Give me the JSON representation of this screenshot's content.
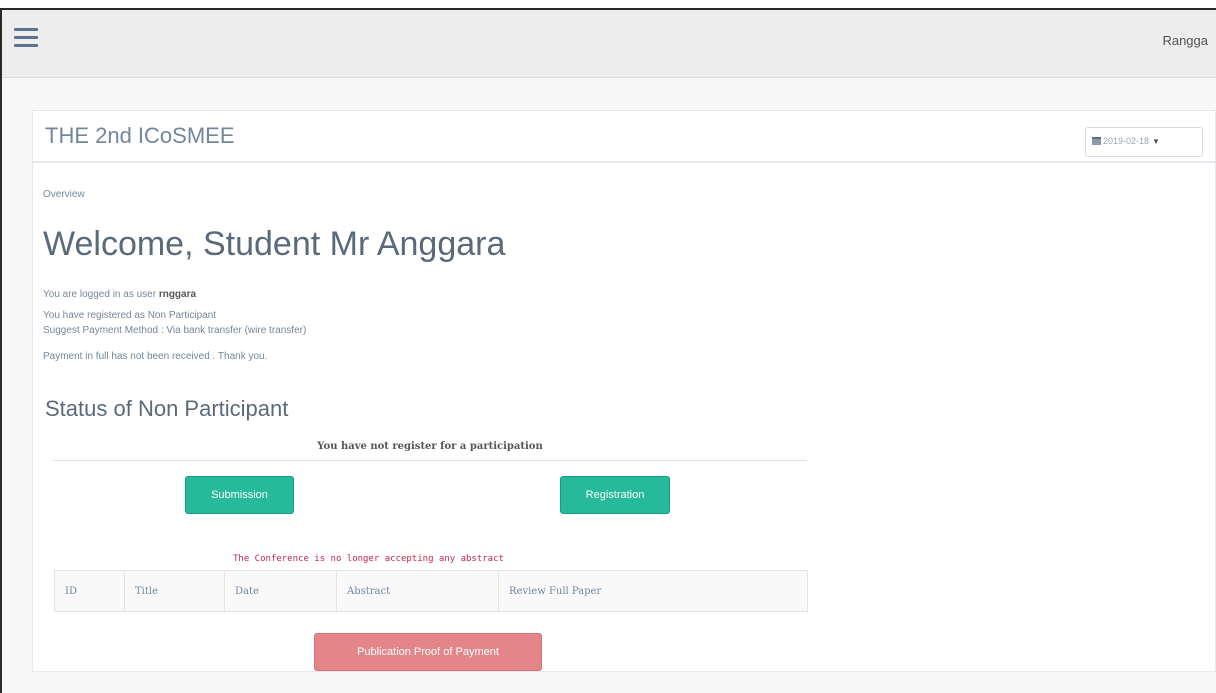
{
  "header": {
    "username": "Rangga"
  },
  "panel": {
    "title": "THE 2nd ICoSMEE",
    "date_selected": "2019-02-18"
  },
  "breadcrumb": "Overview",
  "welcome": {
    "heading": "Welcome, Student Mr Anggara",
    "logged_in_prefix": "You are logged in as user",
    "username": "rnggara",
    "registered_as": "You have registered as Non Participant",
    "payment_method": "Suggest Payment Method : Via bank transfer (wire transfer)",
    "payment_status": "Payment in full has not been received . Thank you."
  },
  "status": {
    "heading": "Status of Non Participant",
    "not_registered_msg": "You have not register for a participation",
    "submission_label": "Submission",
    "registration_label": "Registration",
    "closed_msg": "The Conference is no longer accepting any abstract",
    "table_headers": [
      "ID",
      "Title",
      "Date",
      "Abstract",
      "Review Full Paper"
    ],
    "publication_label": "Publication Proof of Payment"
  }
}
